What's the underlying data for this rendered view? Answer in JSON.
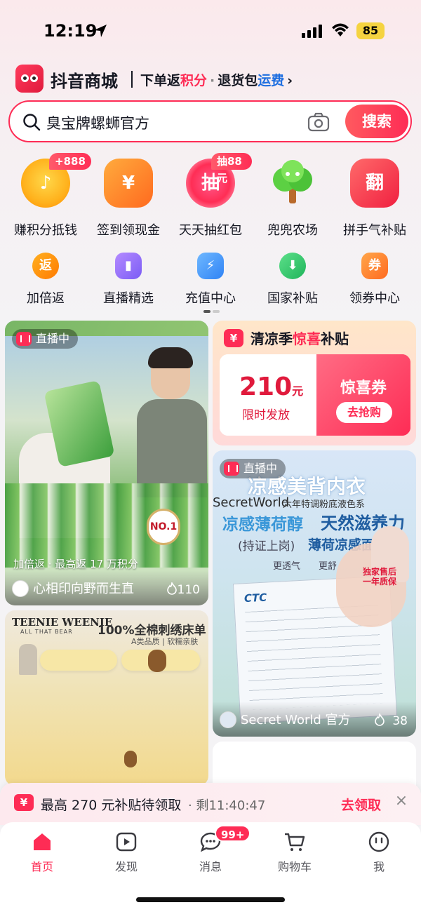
{
  "status_bar": {
    "time": "12:19",
    "battery": "85"
  },
  "header": {
    "brand_title": "抖音商城",
    "promo_part1": "下单返",
    "promo_hl1": "积分",
    "promo_sep": "·",
    "promo_part2": "退货包",
    "promo_hl2": "运费",
    "chevron": "›"
  },
  "search": {
    "query": "臭宝牌螺蛳官方",
    "button_label": "搜索"
  },
  "big_icons": [
    {
      "label": "赚积分抵钱",
      "badge": "+888",
      "glyph": "♪"
    },
    {
      "label": "签到领现金",
      "glyph": "¥"
    },
    {
      "label": "天天抽红包",
      "badge": "抽88元",
      "glyph": "抽"
    },
    {
      "label": "兜兜农场",
      "glyph": ""
    },
    {
      "label": "拼手气补贴",
      "glyph": "翻"
    }
  ],
  "small_icons": [
    {
      "label": "加倍返",
      "glyph": "返"
    },
    {
      "label": "直播精选",
      "glyph": "▮"
    },
    {
      "label": "充值中心",
      "glyph": "⚡"
    },
    {
      "label": "国家补贴",
      "glyph": "⬇"
    },
    {
      "label": "领券中心",
      "glyph": "券"
    }
  ],
  "feed": {
    "live1": {
      "live_label": "直播中",
      "promo": "加倍返 · 最高返 17 万积分",
      "sales_badge": "NO.1",
      "shop": "心相印向野而生直",
      "heat": "110"
    },
    "coupon": {
      "head_icon": "¥",
      "head_prefix": "清凉季",
      "head_hl": "惊喜",
      "head_suffix": "补贴",
      "amount": "210",
      "unit": "元",
      "sub": "限时发放",
      "title": "惊喜券",
      "button": "去抢购"
    },
    "live2": {
      "live_label": "直播中",
      "title": "凉感美背内衣",
      "brand": "SecretWorld",
      "brand_sub": "六年特调粉底液色系",
      "feature1": "凉感薄荷醇",
      "feature1b": "天然滋养力",
      "feature2": "(持证上岗)",
      "feature2b": "薄荷凉感面料",
      "small_labels": "更透气　　更舒",
      "report_logo": "CTC",
      "guarantee": "独家售后\n一年质保",
      "shop": "Secret World 官方",
      "heat": "38"
    },
    "bed": {
      "brand": "TEENIE WEENIE",
      "brand_sub": "ALL THAT BEAR",
      "headline": "100%全棉刺绣床单",
      "sub": "A类品质 | 软糯亲肤"
    }
  },
  "claim_bar": {
    "icon": "¥",
    "text": "最高 270 元补贴待领取",
    "time": "· 剩11:40:47",
    "link": "去领取",
    "close": "×"
  },
  "tabs": [
    {
      "label": "首页",
      "active": true
    },
    {
      "label": "发现"
    },
    {
      "label": "消息",
      "badge": "99+"
    },
    {
      "label": "购物车"
    },
    {
      "label": "我"
    }
  ],
  "colors": {
    "accent": "#fe2c55",
    "link_blue": "#1f6fe0"
  }
}
